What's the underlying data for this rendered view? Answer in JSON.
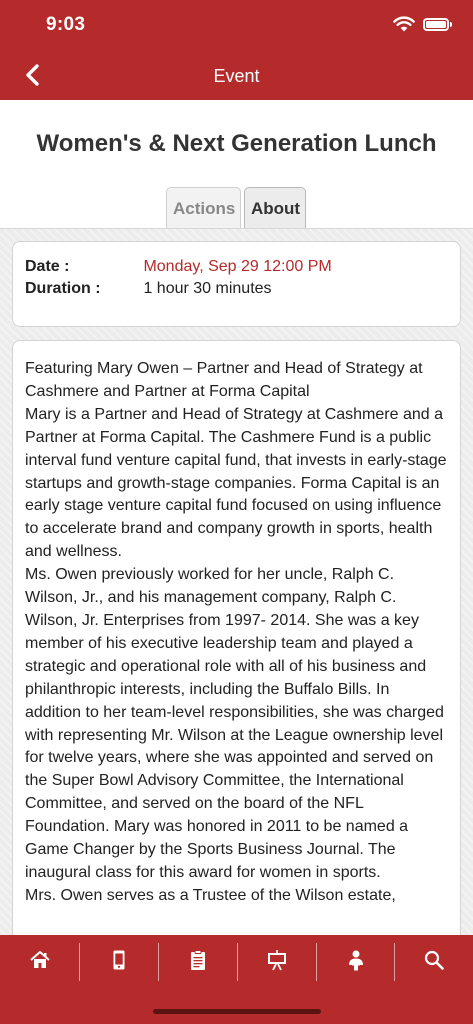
{
  "status_bar": {
    "time": "9:03"
  },
  "header": {
    "title": "Event"
  },
  "event": {
    "title": "Women's & Next Generation Lunch"
  },
  "tabs": [
    {
      "label": "Actions"
    },
    {
      "label": "About"
    }
  ],
  "details": {
    "date_label": "Date :",
    "date_value": "Monday, Sep 29 12:00 PM",
    "duration_label": "Duration :",
    "duration_value": "1 hour 30 minutes"
  },
  "description": "Featuring Mary Owen – Partner and Head of Strategy at Cashmere and Partner at Forma Capital\nMary is a Partner and Head of Strategy at Cashmere and a Partner at Forma Capital. The Cashmere Fund is a public interval fund venture capital fund, that invests in early-stage startups and growth-stage companies. Forma Capital is an early stage venture capital fund focused on using influence to accelerate brand and company growth in sports, health and wellness.\nMs. Owen previously worked for her uncle, Ralph C. Wilson, Jr., and his management company, Ralph C. Wilson, Jr. Enterprises from 1997- 2014. She was a key member of his executive leadership team and played a strategic and operational role with all of his business and philanthropic interests, including the Buffalo Bills. In addition to her team-level responsibilities, she was charged with representing Mr. Wilson at the League ownership level for twelve years, where she was appointed and served on the Super Bowl Advisory Committee, the International Committee, and served on the board of the NFL Foundation. Mary was honored in 2011 to be named a Game Changer by the Sports Business Journal. The inaugural class for this award for women in sports.\nMrs. Owen serves as a Trustee of the Wilson estate,",
  "bottom_nav": [
    {
      "icon": "home-icon"
    },
    {
      "icon": "mobile-device-icon"
    },
    {
      "icon": "clipboard-icon"
    },
    {
      "icon": "presentation-board-icon"
    },
    {
      "icon": "speaker-icon"
    },
    {
      "icon": "search-icon"
    }
  ],
  "colors": {
    "brand_red": "#b52a2a",
    "date_red": "#b52a2a",
    "background": "#ececec"
  }
}
